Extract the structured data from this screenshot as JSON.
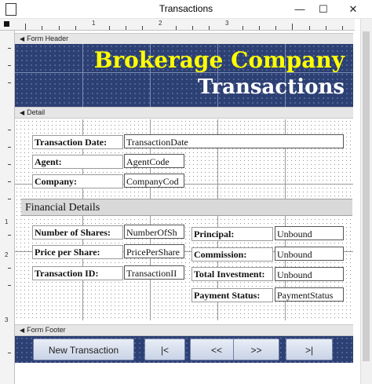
{
  "window": {
    "title": "Transactions",
    "minimize": "—",
    "maximize": "☐",
    "close": "✕"
  },
  "sections": {
    "header": "Form Header",
    "detail": "Detail",
    "footer": "Form Footer"
  },
  "header": {
    "title": "Brokerage Company",
    "subtitle": "Transactions"
  },
  "ruler": {
    "marks": [
      "1",
      "2",
      "3"
    ]
  },
  "detail": {
    "transaction_date": {
      "label": "Transaction Date:",
      "value": "TransactionDate"
    },
    "agent": {
      "label": "Agent:",
      "value": "AgentCode"
    },
    "company": {
      "label": "Company:",
      "value": "CompanyCod"
    },
    "financial_title": "Financial Details",
    "shares": {
      "label": "Number of Shares:",
      "value": "NumberOfSh"
    },
    "price": {
      "label": "Price per Share:",
      "value": "PricePerShare"
    },
    "transaction_id": {
      "label": "Transaction ID:",
      "value": "TransactionII"
    },
    "principal": {
      "label": "Principal:",
      "value": "Unbound"
    },
    "commission": {
      "label": "Commission:",
      "value": "Unbound"
    },
    "total": {
      "label": "Total Investment:",
      "value": "Unbound"
    },
    "payment": {
      "label": "Payment Status:",
      "value": "PaymentStatus"
    }
  },
  "footer": {
    "new_transaction": "New Transaction",
    "first": "|<",
    "prev": "<<",
    "next": ">>",
    "last": ">|"
  },
  "colors": {
    "header_bg": "#2d4073",
    "title_yellow": "#ffff00",
    "subtitle_white": "#ffffff"
  }
}
